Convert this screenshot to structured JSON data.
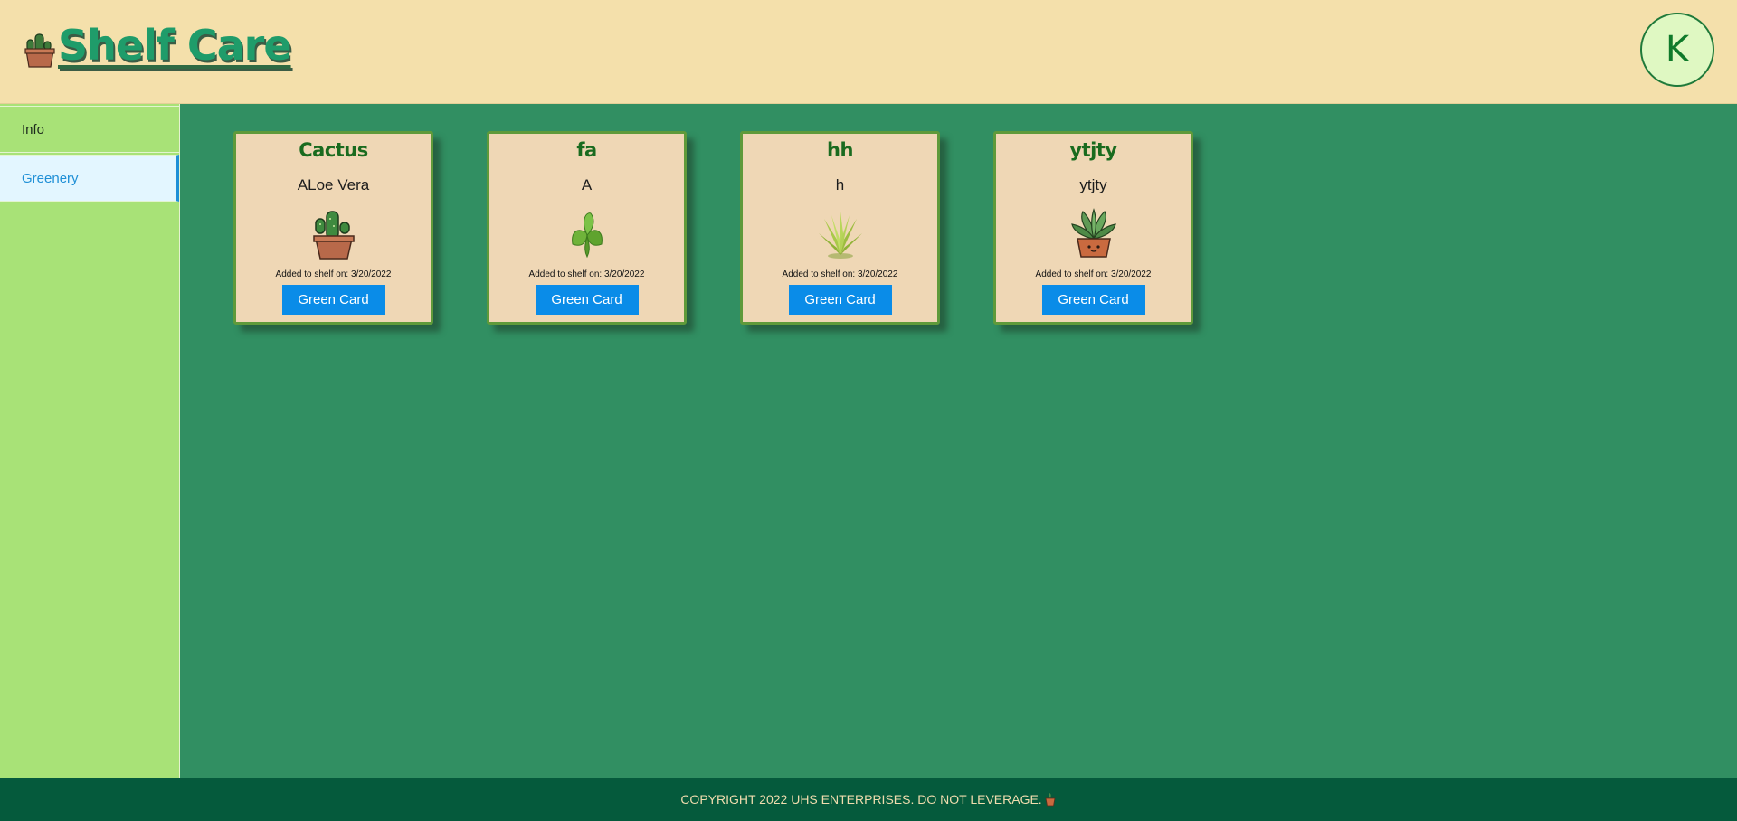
{
  "header": {
    "title": "Shelf Care",
    "logo_icon": "cactus-pot-icon",
    "avatar_initial": "K"
  },
  "sidebar": {
    "items": [
      {
        "label": "Info",
        "active": false
      },
      {
        "label": "Greenery",
        "active": true
      }
    ]
  },
  "cards": [
    {
      "title": "Cactus",
      "subtitle": "ALoe Vera",
      "icon": "cactus-pot-icon",
      "date_label": "Added to shelf on: 3/20/2022",
      "button_label": "Green Card"
    },
    {
      "title": "fa",
      "subtitle": "A",
      "icon": "basil-leaves-icon",
      "date_label": "Added to shelf on: 3/20/2022",
      "button_label": "Green Card"
    },
    {
      "title": "hh",
      "subtitle": "h",
      "icon": "aloe-plant-icon",
      "date_label": "Added to shelf on: 3/20/2022",
      "button_label": "Green Card"
    },
    {
      "title": "ytjty",
      "subtitle": "ytjty",
      "icon": "succulent-pot-icon",
      "date_label": "Added to shelf on: 3/20/2022",
      "button_label": "Green Card"
    }
  ],
  "footer": {
    "text": "COPYRIGHT 2022 UHS ENTERPRISES. DO NOT LEVERAGE.",
    "icon": "pot-icon"
  },
  "colors": {
    "header_bg": "#f4e0ab",
    "main_bg": "#318f62",
    "sidebar_bg": "#a8e277",
    "card_bg": "#efd7b5",
    "button_bg": "#0a8ce8",
    "footer_bg": "#055a3c",
    "title_green": "#1f9c6a"
  }
}
